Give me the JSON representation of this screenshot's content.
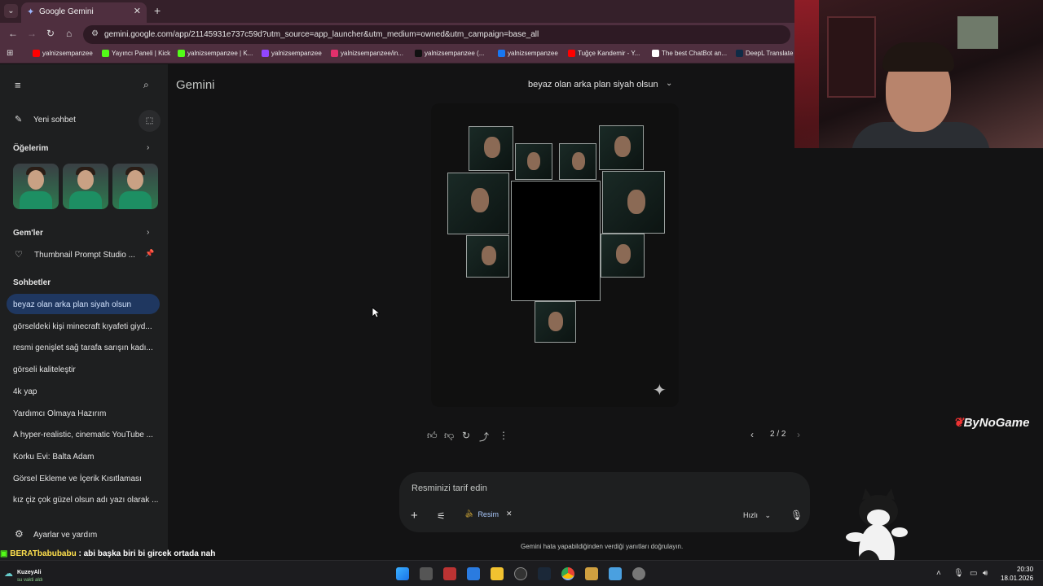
{
  "browser": {
    "tab_title": "Google Gemini",
    "url": "gemini.google.com/app/21145931e737c59d?utm_source=app_launcher&utm_medium=owned&utm_campaign=base_all",
    "bookmarks": [
      {
        "label": "yalnizsempanzee",
        "color": "#ff0000"
      },
      {
        "label": "Yayıncı Paneli | Kick",
        "color": "#53fc18"
      },
      {
        "label": "yalnizsempanzee | K...",
        "color": "#53fc18"
      },
      {
        "label": "yalnizsempanzee",
        "color": "#9146ff"
      },
      {
        "label": "yalnizsempanzee/in...",
        "color": "#e1306c"
      },
      {
        "label": "yalnizsempanzee (...",
        "color": "#111111"
      },
      {
        "label": "yalnizsempanzee",
        "color": "#1877f2"
      },
      {
        "label": "Tuğçe Kandemir - Y...",
        "color": "#ff0000"
      },
      {
        "label": "The best ChatBot an...",
        "color": "#ffffff"
      },
      {
        "label": "DeepL Translate",
        "color": "#0f2b46"
      }
    ]
  },
  "sidebar": {
    "new_chat": "Yeni sohbet",
    "items_heading": "Öğelerim",
    "gems_heading": "Gem'ler",
    "gem_item": "Thumbnail Prompt Studio ...",
    "chats_heading": "Sohbetler",
    "chats": [
      "beyaz olan arka plan siyah olsun",
      "görseldeki kişi minecraft kıyafeti giyd...",
      "resmi genişlet sağ tarafa sarışın kadı...",
      "görseli kaliteleştir",
      "4k yap",
      "Yardımcı Olmaya Hazırım",
      "A hyper-realistic, cinematic YouTube ...",
      "Korku Evi: Balta Adam",
      "Görsel Ekleme ve İçerik Kısıtlaması",
      "kız çiz çok güzel olsun adı yazı olarak ..."
    ],
    "settings": "Ayarlar ve yardım"
  },
  "main": {
    "brand": "Gemini",
    "chat_title": "beyaz olan arka plan siyah olsun",
    "pager": "2 / 2"
  },
  "composer": {
    "placeholder": "Resminizi tarif edin",
    "chip_label": "Resim",
    "mode_label": "Hızlı",
    "disclaimer": "Gemini hata yapabildiğinden verdiği yanıtları doğrulayın."
  },
  "overlay": {
    "brand_logo": "ByNoGame",
    "chat_user": "BERATbabubabu",
    "chat_message": " : abi başka biri bi gircek ortada nah"
  },
  "taskbar": {
    "weather_title": "KuzeyAli",
    "weather_sub": "su vakti aldı",
    "time": "20:30",
    "date": "18.01.2026"
  },
  "colors": {
    "accent": "#1f3760",
    "browser_frame": "#4f2f3f",
    "background": "#131314"
  }
}
